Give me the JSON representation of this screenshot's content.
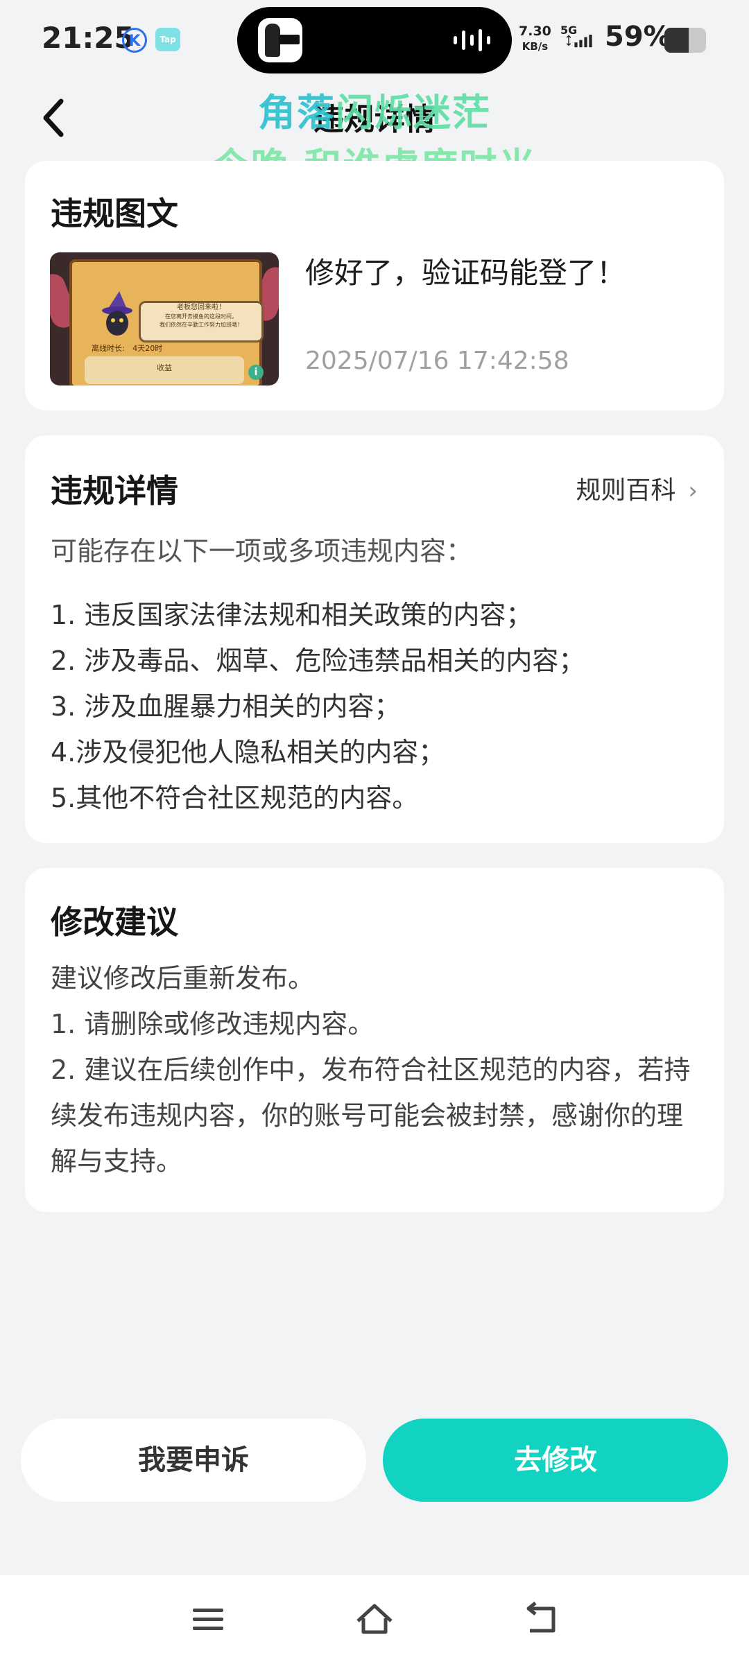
{
  "status_bar": {
    "time": "21:25",
    "app_badge_k": "K",
    "app_badge_tap": "Tap",
    "speed_value": "7.30",
    "speed_unit": "KB/s",
    "network": "5G",
    "battery_pct": "59%",
    "battery_level": 0.59
  },
  "header": {
    "title": "违规详情",
    "lyric_line1_a": "角落",
    "lyric_line1_b": "闪烁迷茫",
    "lyric_line2": "今晚 和谁虚度时光"
  },
  "violation_post": {
    "section_title": "违规图文",
    "post_text": "修好了，验证码能登了！",
    "post_time": "2025/07/16 17:42:58",
    "thumb_bubble_lines": [
      "老板您回来啦！",
      "在您离开去摸鱼的这段时间，",
      "我们依然在辛勤工作努力加班哦！"
    ],
    "thumb_row_label": "离线时长:",
    "thumb_row_value": "4天20时",
    "thumb_bar_label": "收益"
  },
  "violation_details": {
    "section_title": "违规详情",
    "rules_link": "规则百科",
    "intro": "可能存在以下一项或多项违规内容：",
    "items": [
      "1. 违反国家法律法规和相关政策的内容；",
      "2. 涉及毒品、烟草、危险违禁品相关的内容；",
      "3. 涉及血腥暴力相关的内容；",
      "4.涉及侵犯他人隐私相关的内容；",
      "5.其他不符合社区规范的内容。"
    ]
  },
  "suggestions": {
    "section_title": "修改建议",
    "lines": [
      "建议修改后重新发布。",
      "1. 请删除或修改违规内容。",
      "2. 建议在后续创作中，发布符合社区规范的内容，若持续发布违规内容，你的账号可能会被封禁，感谢你的理解与支持。"
    ]
  },
  "actions": {
    "appeal_label": "我要申诉",
    "modify_label": "去修改"
  },
  "colors": {
    "accent": "#12d3c1",
    "background": "#f2f3f5",
    "card": "#ffffff"
  }
}
